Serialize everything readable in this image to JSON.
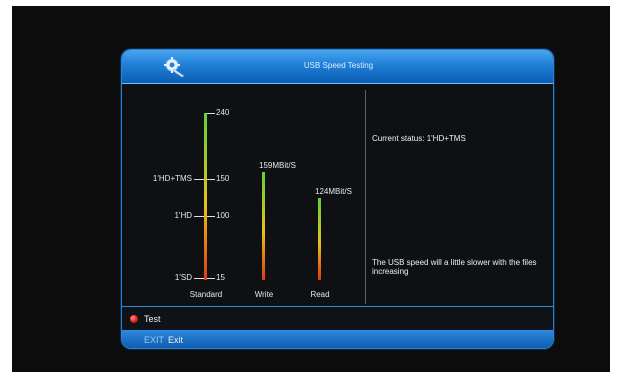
{
  "window": {
    "title": "USB Speed Testing"
  },
  "chart_data": {
    "type": "bar",
    "categories": [
      "Standard",
      "Write",
      "Read"
    ],
    "values": [
      240,
      159,
      124
    ],
    "value_labels": [
      "",
      "159MBit/S",
      "124MBit/S"
    ],
    "scale_ticks": [
      {
        "value": 240,
        "label": "240",
        "name": ""
      },
      {
        "value": 150,
        "label": "150",
        "name": "1'HD+TMS"
      },
      {
        "value": 100,
        "label": "100",
        "name": "1'HD"
      },
      {
        "value": 15,
        "label": "15",
        "name": "1'SD"
      }
    ],
    "ylim": [
      15,
      240
    ]
  },
  "status": {
    "current": "Current status: 1'HD+TMS",
    "note": "The USB speed will a little slower with the files increasing"
  },
  "footer": {
    "test_label": "Test",
    "exit_key": "EXIT",
    "exit_label": "Exit"
  },
  "colors": {
    "bar_top": "#5fd13a",
    "bar_mid": "#e6c21c",
    "bar_bottom": "#e03a12",
    "accent_blue": "#2f8ae0"
  }
}
